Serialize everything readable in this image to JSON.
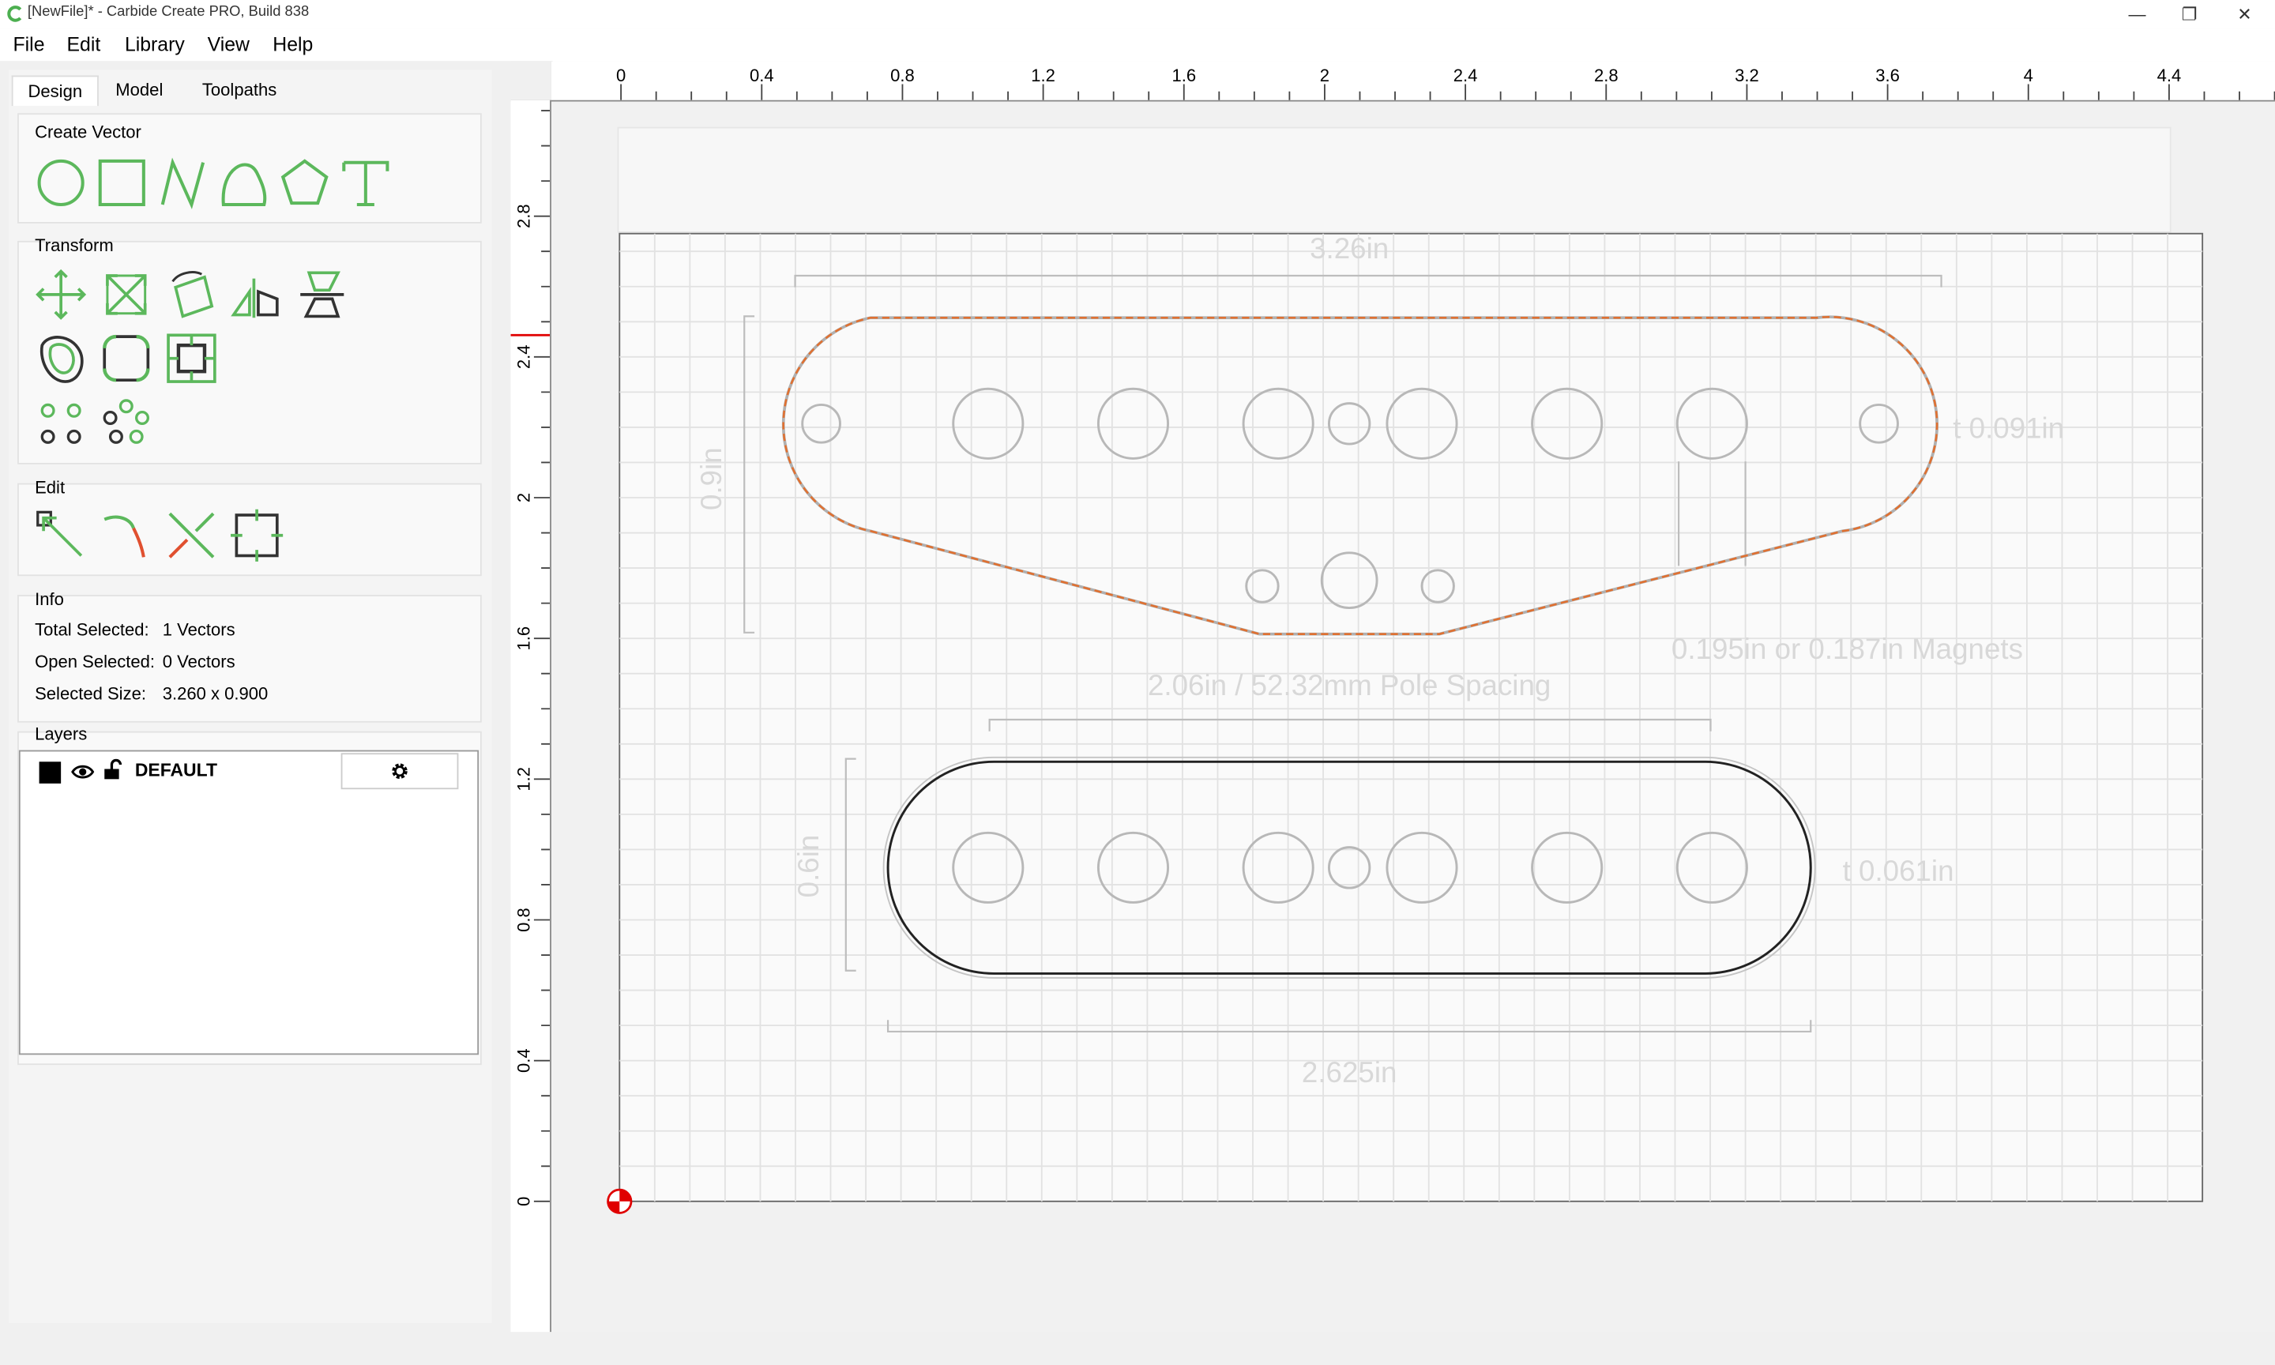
{
  "window": {
    "title": "[NewFile]* - Carbide Create PRO, Build 838",
    "minimize_glyph": "—",
    "restore_glyph": "❐",
    "close_glyph": "✕"
  },
  "menu": {
    "file": "File",
    "edit": "Edit",
    "library": "Library",
    "view": "View",
    "help": "Help"
  },
  "tabs": {
    "design": "Design",
    "model": "Model",
    "toolpaths": "Toolpaths"
  },
  "sections": {
    "create_vector": "Create Vector",
    "transform": "Transform",
    "edit": "Edit",
    "info": "Info",
    "layers": "Layers"
  },
  "info": {
    "total_selected_label": "Total Selected:",
    "total_selected_value": "1 Vectors",
    "open_selected_label": "Open Selected:",
    "open_selected_value": "0 Vectors",
    "selected_size_label": "Selected Size:",
    "selected_size_value": "3.260 x 0.900"
  },
  "layers": {
    "items": [
      {
        "name": "DEFAULT",
        "color": "#000000",
        "visible": true,
        "locked": false
      }
    ]
  },
  "rulers": {
    "top": [
      "0",
      "0.4",
      "0.8",
      "1.2",
      "1.6",
      "2",
      "2.4",
      "2.8",
      "3.2",
      "3.6",
      "4",
      "4.4"
    ],
    "left": [
      "2.8",
      "2.4",
      "2",
      "1.6",
      "1.2",
      "0.8",
      "0.4",
      "0"
    ]
  },
  "template_text": {
    "top_width": "3.26in",
    "top_height": "0.9in",
    "top_thickness": "t 0.091in",
    "magnets": "0.195in or 0.187in Magnets",
    "pole_spacing": "2.06in / 52.32mm Pole Spacing",
    "bottom_height": "0.6in",
    "bottom_thickness": "t 0.061in",
    "bottom_width": "2.625in"
  },
  "colors": {
    "accent_green": "#5cb85c",
    "selection_orange": "#e07030",
    "origin_red": "#e00000"
  }
}
